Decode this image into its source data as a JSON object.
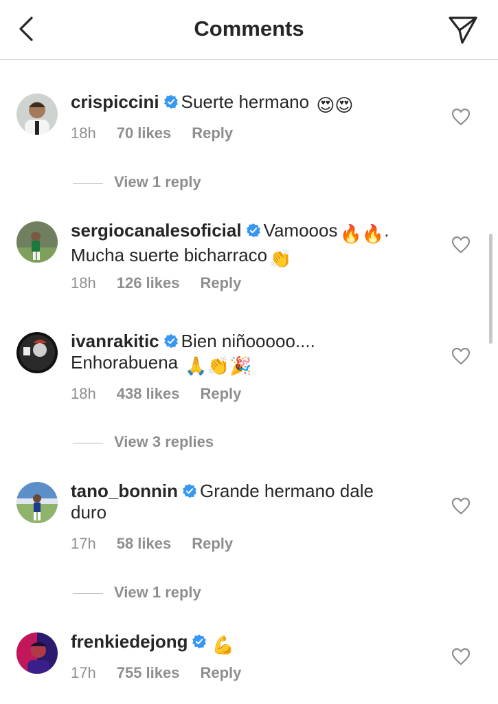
{
  "header": {
    "title": "Comments"
  },
  "icons": {
    "back": "chevron-left-icon",
    "send": "paper-plane-icon",
    "like": "heart-outline-icon",
    "verified": "verified-badge-icon"
  },
  "colors": {
    "verified": "#3897f0",
    "meta": "#8e8e8e",
    "text": "#262626"
  },
  "comments": [
    {
      "username": "crispiccini",
      "text": "Suerte hermano",
      "emoji": "😍😍",
      "time": "18h",
      "likes": "70 likes",
      "reply": "Reply",
      "view_replies": "View 1 reply"
    },
    {
      "username": "sergiocanalesoficial",
      "text": "Vamooos",
      "emoji_a": "🔥🔥",
      "text_b": ".",
      "text_2": "Mucha suerte bicharraco",
      "emoji_2": "👏",
      "time": "18h",
      "likes": "126 likes",
      "reply": "Reply"
    },
    {
      "username": "ivanrakitic",
      "text": "Bien niñooooo....",
      "text_2": "Enhorabuena",
      "emoji_2": "🙏👏🎉",
      "time": "18h",
      "likes": "438 likes",
      "reply": "Reply",
      "view_replies": "View 3 replies"
    },
    {
      "username": "tano_bonnin",
      "text": "Grande hermano dale",
      "text_2": "duro",
      "time": "17h",
      "likes": "58 likes",
      "reply": "Reply",
      "view_replies": "View 1 reply"
    },
    {
      "username": "frenkiedejong",
      "emoji": "💪",
      "time": "17h",
      "likes": "755 likes",
      "reply": "Reply"
    }
  ]
}
